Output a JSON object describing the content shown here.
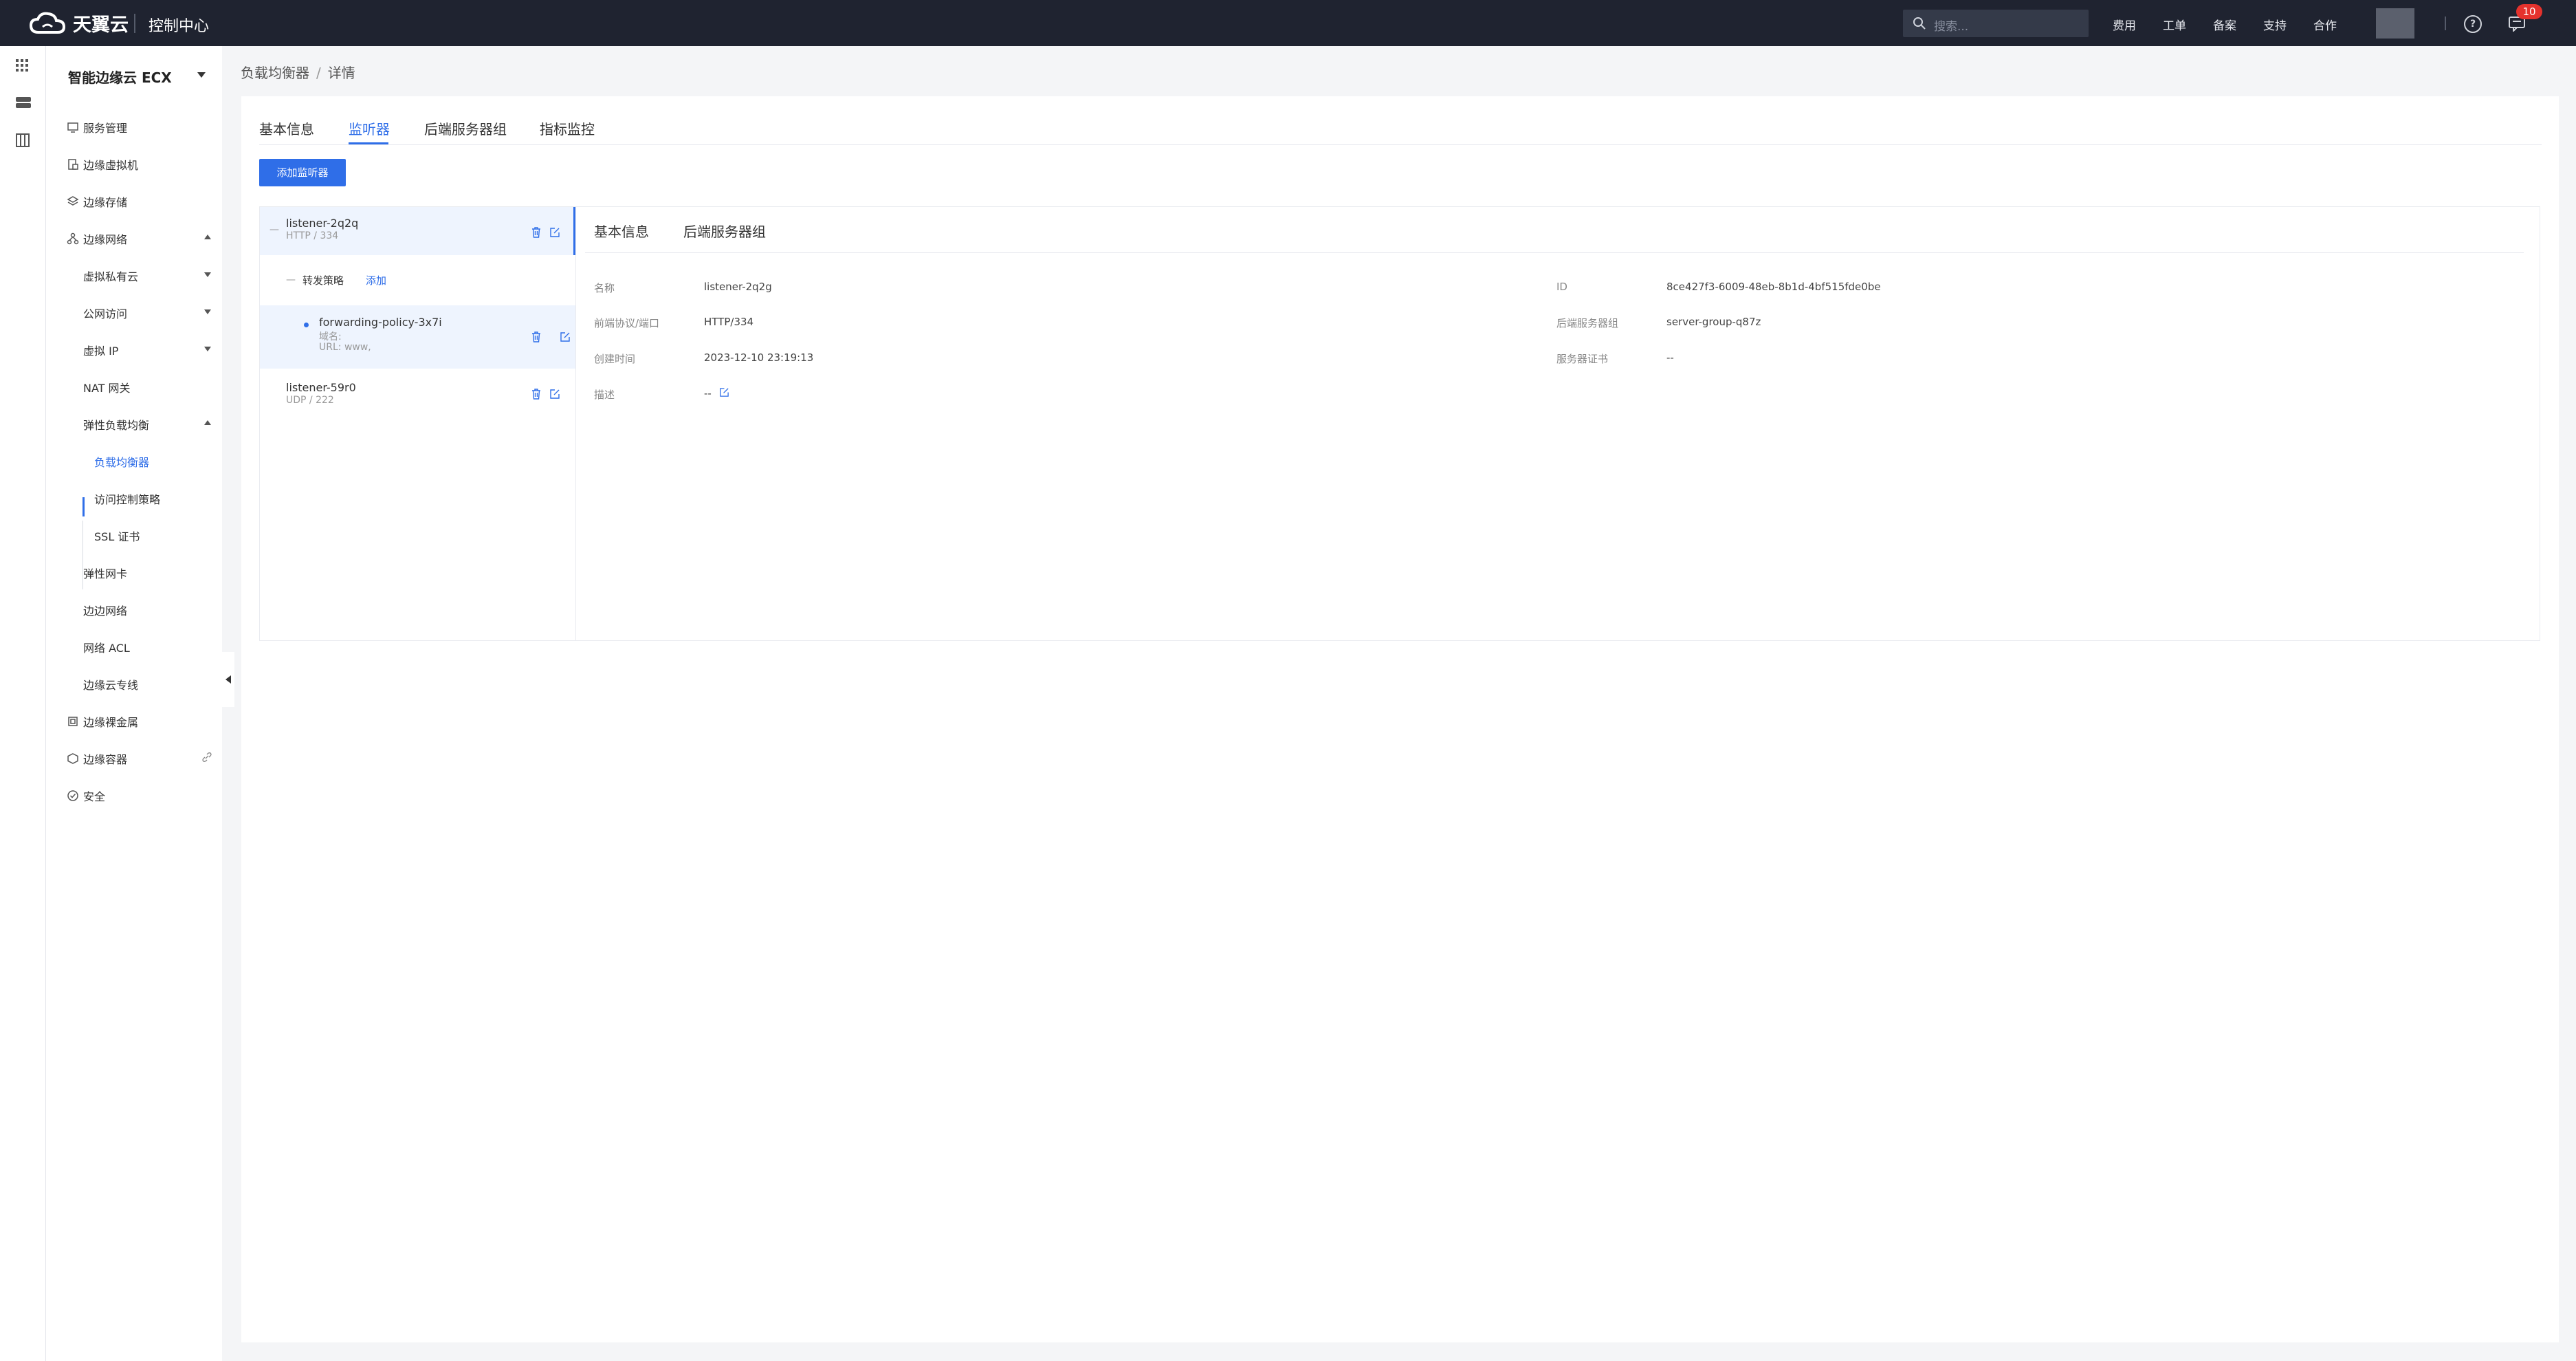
{
  "topbar": {
    "brand": "天翼云",
    "console": "控制中心",
    "search_placeholder": "搜索...",
    "nav": [
      "费用",
      "工单",
      "备案",
      "支持",
      "合作"
    ],
    "notification_count": "10"
  },
  "menu": {
    "title": "智能边缘云 ECX",
    "items": {
      "service": "服务管理",
      "vm": "边缘虚拟机",
      "storage": "边缘存储",
      "network": "边缘网络",
      "vpc": "虚拟私有云",
      "public": "公网访问",
      "vip": "虚拟 IP",
      "nat": "NAT 网关",
      "elb": "弹性负载均衡",
      "lb": "负载均衡器",
      "acl_policy": "访问控制策略",
      "ssl": "SSL 证书",
      "eni": "弹性网卡",
      "peering": "边边网络",
      "network_acl": "网络 ACL",
      "dc": "边缘云专线",
      "bare": "边缘裸金属",
      "container": "边缘容器",
      "security": "安全"
    }
  },
  "breadcrumb": {
    "parent": "负载均衡器",
    "current": "详情"
  },
  "tabs": [
    "基本信息",
    "监听器",
    "后端服务器组",
    "指标监控"
  ],
  "add_listener": "添加监听器",
  "listeners": [
    {
      "name": "listener-2q2q",
      "proto": "HTTP / 334"
    },
    {
      "name": "listener-59r0",
      "proto": "UDP / 222"
    }
  ],
  "forwarding": {
    "label": "转发策略",
    "add": "添加",
    "policy_name": "forwarding-policy-3x7i",
    "domain_label": "域名:",
    "url_label": "URL: www,"
  },
  "detail_tabs": [
    "基本信息",
    "后端服务器组"
  ],
  "detail": {
    "name_label": "名称",
    "name": "listener-2q2g",
    "port_label": "前端协议/端口",
    "port": "HTTP/334",
    "created_label": "创建时间",
    "created": "2023-12-10 23:19:13",
    "desc_label": "描述",
    "desc": "--",
    "id_label": "ID",
    "id": "8ce427f3-6009-48eb-8b1d-4bf515fde0be",
    "group_label": "后端服务器组",
    "group": "server-group-q87z",
    "cert_label": "服务器证书",
    "cert": "--"
  },
  "colors": {
    "accent": "#2f6ee8",
    "topbar": "#1f2330",
    "badge": "#e5322d"
  }
}
